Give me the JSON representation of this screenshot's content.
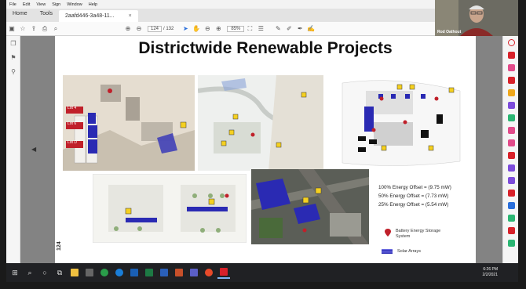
{
  "menu": [
    "File",
    "Edit",
    "View",
    "Sign",
    "Window",
    "Help"
  ],
  "tabs": {
    "home": "Home",
    "tools": "Tools",
    "document": "2aafd446-3a48-11...",
    "close": "×"
  },
  "toolbar": {
    "page_current": "124",
    "page_total": "/ 132",
    "zoom": "85%"
  },
  "slide": {
    "title": "Districtwide Renewable Projects",
    "page_number": "124",
    "lot_labels": [
      "Lot 4",
      "Lot 6",
      "Lot D"
    ],
    "energy_offsets": [
      "100% Energy Offset = (9.75 mW)",
      "50% Energy Offset = (7.73 mW)",
      "25% Energy Offset = (5.54 mW)"
    ],
    "legend": {
      "battery": "Battery Energy Storage System",
      "solar": "Solar Arrays"
    },
    "map_numbers": [
      "1",
      "2",
      "3",
      "4",
      "5",
      "6"
    ]
  },
  "webcam": {
    "name": "Rod Oathout"
  },
  "clock": {
    "time": "6:26 PM",
    "date": "2/2/2021"
  },
  "colors": {
    "solar": "#2a2ab3",
    "pin": "#c0202a",
    "acrobat": "#d8212a",
    "tag": "#f5d020"
  }
}
